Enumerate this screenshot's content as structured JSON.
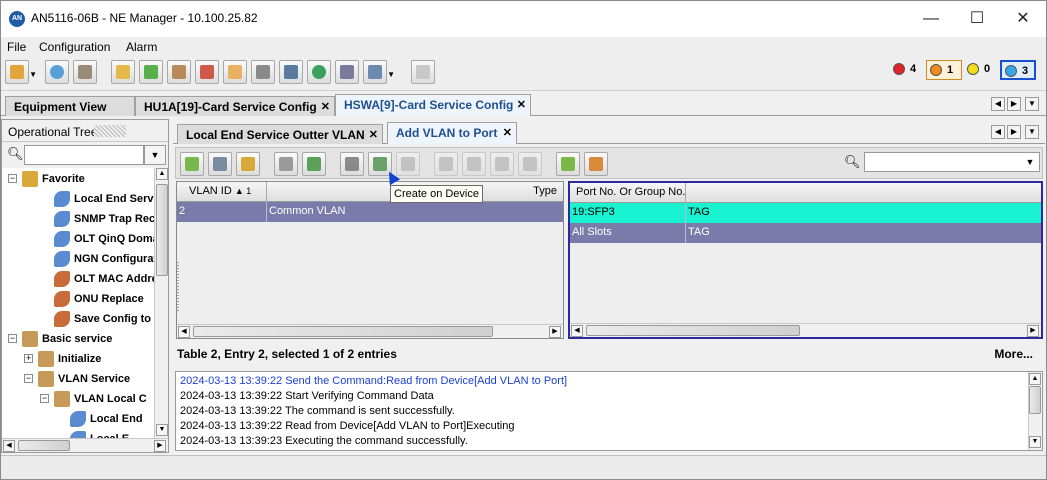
{
  "window": {
    "title": "AN5116-06B - NE Manager - 10.100.25.82",
    "app_icon_text": "AN",
    "minimize": "—",
    "maximize": "☐",
    "close": "✕"
  },
  "menu": {
    "file": "File",
    "configuration": "Configuration",
    "alarm": "Alarm"
  },
  "alarms": [
    {
      "color": "#e0242a",
      "count": "4"
    },
    {
      "color": "#f08a1c",
      "count": "1"
    },
    {
      "color": "#f2dc1a",
      "count": "0"
    },
    {
      "color": "#35a7e8",
      "count": "3"
    }
  ],
  "main_tabs": [
    {
      "label": "Equipment View",
      "closable": false
    },
    {
      "label": "HU1A[19]-Card Service Config",
      "closable": true
    },
    {
      "label": "HSWA[9]-Card Service Config",
      "closable": true,
      "active": true
    }
  ],
  "left_pane": {
    "header": "Operational Tree",
    "tree": [
      {
        "level": 0,
        "expander": "−",
        "icon": "star-folder-icon",
        "label": "Favorite"
      },
      {
        "level": 2,
        "expander": "",
        "icon": "wrench-icon",
        "label": "Local End Servic"
      },
      {
        "level": 2,
        "expander": "",
        "icon": "wrench-icon",
        "label": "SNMP Trap Rece"
      },
      {
        "level": 2,
        "expander": "",
        "icon": "wrench-icon",
        "label": "OLT QinQ Domai"
      },
      {
        "level": 2,
        "expander": "",
        "icon": "wrench-icon",
        "label": "NGN Configuratio"
      },
      {
        "level": 2,
        "expander": "",
        "icon": "tools-icon",
        "label": "OLT MAC Addre"
      },
      {
        "level": 2,
        "expander": "",
        "icon": "tools-icon",
        "label": "ONU Replace"
      },
      {
        "level": 2,
        "expander": "",
        "icon": "tools-icon",
        "label": "Save Config to F"
      },
      {
        "level": 0,
        "expander": "−",
        "icon": "config-folder-icon",
        "label": "Basic service"
      },
      {
        "level": 1,
        "expander": "+",
        "icon": "config-folder-icon",
        "label": "Initialize"
      },
      {
        "level": 1,
        "expander": "−",
        "icon": "config-folder-icon",
        "label": "VLAN Service"
      },
      {
        "level": 2,
        "expander": "−",
        "icon": "config-folder-icon",
        "label": "VLAN Local C"
      },
      {
        "level": 3,
        "expander": "",
        "icon": "wrench-icon",
        "label": "Local End"
      },
      {
        "level": 3,
        "expander": "",
        "icon": "wrench-icon",
        "label": "Local E"
      }
    ]
  },
  "sub_tabs": [
    {
      "label": "Local End Service Outter VLAN",
      "closable": true
    },
    {
      "label": "Add VLAN to Port",
      "closable": true,
      "active": true
    }
  ],
  "tooltip": "Create on Device",
  "left_grid": {
    "columns": [
      "VLAN ID",
      "Type"
    ],
    "sort_indicator": "▲ 1",
    "rows": [
      {
        "vlan_id": "2",
        "type": "Common VLAN"
      }
    ]
  },
  "right_grid": {
    "columns": [
      "Port No. Or Group No.",
      ""
    ],
    "rows": [
      {
        "port": "19:SFP3",
        "mode": "TAG",
        "highlight": true
      },
      {
        "port": "All Slots",
        "mode": "TAG",
        "highlight": false
      }
    ]
  },
  "status": {
    "text": "Table 2, Entry 2, selected 1 of 2 entries",
    "more": "More..."
  },
  "log": [
    {
      "text": "2024-03-13 13:39:22 Send the Command:Read from Device[Add VLAN to Port]",
      "color": "#1a3fd6"
    },
    {
      "text": "2024-03-13 13:39:22 Start Verifying Command Data",
      "color": "#000000"
    },
    {
      "text": "2024-03-13 13:39:22 The command is sent successfully.",
      "color": "#000000"
    },
    {
      "text": "2024-03-13 13:39:22 Read from Device[Add VLAN to Port]Executing",
      "color": "#000000"
    },
    {
      "text": "2024-03-13 13:39:23 Executing the command successfully.",
      "color": "#000000"
    }
  ],
  "colors": {
    "selected_row": "#7b7bab",
    "highlight_row": "#19f2d0",
    "active_tab_text": "#1f4f8f"
  }
}
